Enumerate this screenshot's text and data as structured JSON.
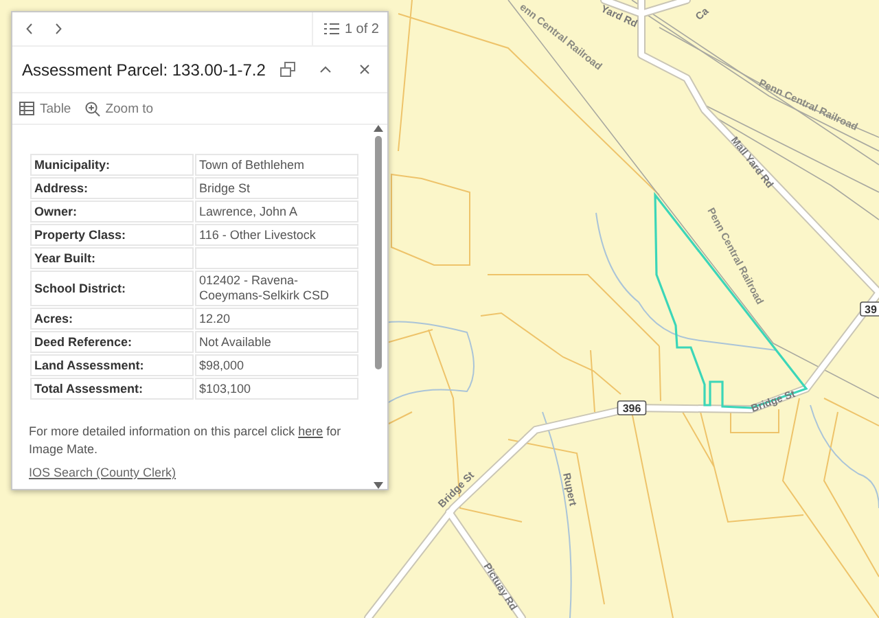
{
  "panel": {
    "page_indicator": "1 of 2",
    "title": "Assessment Parcel: 133.00-1-7.2",
    "actions": [
      {
        "kind": "table",
        "label": "Table"
      },
      {
        "kind": "zoom",
        "label": "Zoom to"
      }
    ],
    "attributes": [
      {
        "label": "Municipality:",
        "value": "Town of Bethlehem"
      },
      {
        "label": "Address:",
        "value": "Bridge St"
      },
      {
        "label": "Owner:",
        "value": "Lawrence, John A"
      },
      {
        "label": "Property Class:",
        "value": "116 - Other Livestock"
      },
      {
        "label": "Year Built:"
      },
      {
        "label": "School District:",
        "value": "012402 - Ravena-Coeymans-Selkirk CSD"
      },
      {
        "label": "Acres:",
        "value": "12.20"
      },
      {
        "label": "Deed Reference:",
        "value": "Not Available"
      },
      {
        "label": "Land Assessment:",
        "value": "$98,000"
      },
      {
        "label": "Total Assessment:",
        "value": "$103,100"
      }
    ],
    "note": {
      "before": "For more detailed information on this parcel click",
      "link": "here",
      "after": "for Image Mate."
    },
    "next_link": "IOS Search (County Clerk)"
  },
  "map": {
    "labels": [
      {
        "kind": "rail",
        "text": "enn Central Railroad"
      },
      {
        "kind": "road",
        "text": "Yard Rd"
      },
      {
        "kind": "road",
        "text": "Ca"
      },
      {
        "kind": "rail",
        "text": "Penn Central Railroad"
      },
      {
        "kind": "road",
        "text": "Mall Yard Rd"
      },
      {
        "kind": "rail",
        "text": "Penn Central Railroad"
      },
      {
        "kind": "shield",
        "text": "39"
      },
      {
        "kind": "shield",
        "text": "396"
      },
      {
        "kind": "road",
        "text": "Bridge St"
      },
      {
        "kind": "road",
        "text": "Bridge St"
      },
      {
        "kind": "road",
        "text": "Rupert"
      },
      {
        "kind": "road",
        "text": "Pictuay Rd"
      }
    ]
  }
}
